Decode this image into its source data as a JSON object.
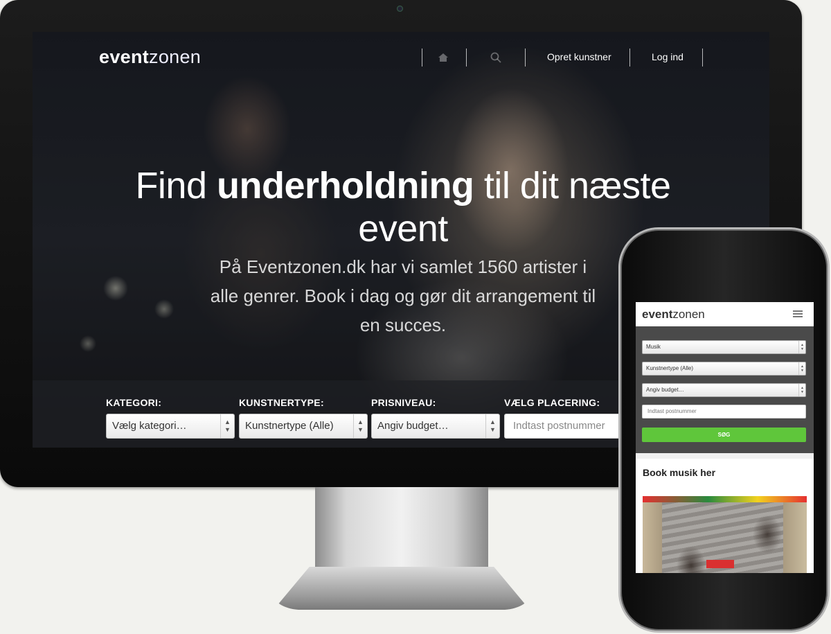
{
  "desktop": {
    "logo": {
      "bold": "event",
      "light": "zonen"
    },
    "nav": {
      "home_icon": "home-icon",
      "search_icon": "search-icon",
      "create_artist": "Opret kunstner",
      "login": "Log ind"
    },
    "hero": {
      "title_pre": "Find ",
      "title_bold": "underholdning",
      "title_post": " til dit næste event",
      "subtitle": "På Eventzonen.dk har vi samlet 1560 artister i alle genrer. Book i dag og gør dit arrangement til en succes."
    },
    "search": {
      "category_label": "KATEGORI:",
      "category_value": "Vælg kategori…",
      "artist_type_label": "KUNSTNERTYPE:",
      "artist_type_value": "Kunstnertype (Alle)",
      "price_label": "PRISNIVEAU:",
      "price_value": "Angiv budget…",
      "location_label": "VÆLG PLACERING:",
      "location_placeholder": "Indtast postnummer"
    }
  },
  "mobile": {
    "logo": {
      "bold": "event",
      "light": "zonen"
    },
    "menu_icon": "hamburger-menu-icon",
    "form": {
      "category_value": "Musik",
      "artist_type_value": "Kunstnertype (Alle)",
      "price_value": "Angiv budget…",
      "postcode_placeholder": "Indtast postnummer",
      "search_button": "SØG"
    },
    "book_title": "Book musik her"
  },
  "colors": {
    "accent_green": "#5fc63b",
    "monitor_bezel": "#111111"
  }
}
